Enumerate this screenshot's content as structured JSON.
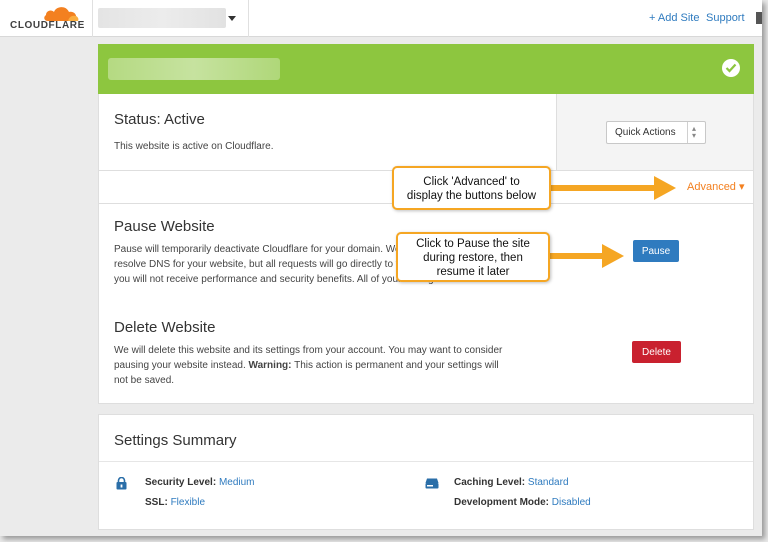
{
  "header": {
    "logo_text": "CLOUDFLARE",
    "add_site": "+ Add Site",
    "support": "Support"
  },
  "status": {
    "title": "Status: Active",
    "description": "This website is active on Cloudflare.",
    "quick_actions": "Quick Actions",
    "advanced": "Advanced ▾"
  },
  "pause": {
    "title": "Pause Website",
    "line1": "Pause will temporarily deactivate Cloudflare for your domain. We will continue to",
    "line2": "resolve DNS for your website, but all requests will go directly to your origin and",
    "line3": "you will not receive performance and security benefits. All of your settings will be saved.",
    "button": "Pause"
  },
  "delete": {
    "title": "Delete Website",
    "line1": "We will delete this website and its settings from your account. You may want to consider",
    "line2_pre": "pausing your website instead. ",
    "warning_label": "Warning:",
    "line2_post": " This action is permanent and your settings will",
    "line3": "not be saved.",
    "button": "Delete"
  },
  "settings": {
    "title": "Settings Summary",
    "security_label": "Security Level:",
    "security_value": "Medium",
    "ssl_label": "SSL:",
    "ssl_value": "Flexible",
    "caching_label": "Caching Level:",
    "caching_value": "Standard",
    "devmode_label": "Development Mode:",
    "devmode_value": "Disabled"
  },
  "callouts": {
    "advanced_line1": "Click 'Advanced' to",
    "advanced_line2": "display the buttons below",
    "pause_line1": "Click to Pause the site",
    "pause_line2": "during restore, then",
    "pause_line3": "resume it later"
  },
  "colors": {
    "brand_orange": "#f38020",
    "banner_green": "#8dc63f",
    "link_blue": "#2f7bbf",
    "pause_blue": "#2f7bbf",
    "delete_red": "#c9212f",
    "callout_border": "#f5a623"
  },
  "icons": {
    "logo": "cloud-icon",
    "check": "check-circle-icon",
    "security": "lock-icon",
    "caching": "drive-icon"
  }
}
